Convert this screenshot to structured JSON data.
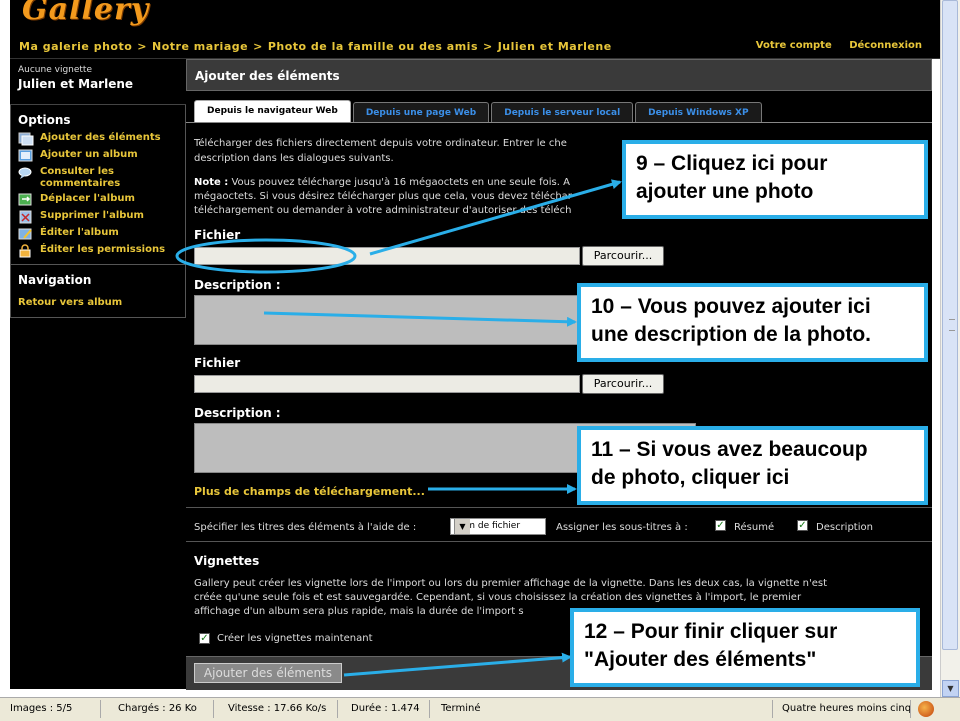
{
  "app": {
    "logo": "Gallery"
  },
  "breadcrumb": {
    "items": [
      "Ma galerie photo",
      "Notre mariage",
      "Photo de la famille ou des amis",
      "Julien et Marlene"
    ],
    "sep": ">"
  },
  "topnav": {
    "account": "Votre compte",
    "logout": "Déconnexion"
  },
  "sidebar": {
    "no_thumb": "Aucune vignette",
    "album_name": "Julien et Marlene",
    "options_title": "Options",
    "items": [
      {
        "label": "Ajouter des éléments",
        "icon": "add-items-icon"
      },
      {
        "label": "Ajouter un album",
        "icon": "add-album-icon"
      },
      {
        "label": "Consulter les commentaires",
        "icon": "comments-icon"
      },
      {
        "label": "Déplacer l'album",
        "icon": "move-icon"
      },
      {
        "label": "Supprimer l'album",
        "icon": "delete-icon"
      },
      {
        "label": "Éditer l'album",
        "icon": "edit-icon"
      },
      {
        "label": "Éditer les permissions",
        "icon": "permissions-icon"
      }
    ],
    "nav_title": "Navigation",
    "back_link": "Retour vers album"
  },
  "main": {
    "title": "Ajouter des éléments",
    "tabs": [
      "Depuis le navigateur Web",
      "Depuis une page Web",
      "Depuis le serveur local",
      "Depuis Windows XP"
    ],
    "intro_line1": "Télécharger des fichiers directement depuis votre ordinateur. Entrer le che",
    "intro_line2": "description dans les dialogues suivants.",
    "note_label": "Note :",
    "note_line1": " Vous pouvez télécharge jusqu'à 16 mégaoctets en une seule fois. A",
    "note_line2": "mégaoctets. Si vous désirez télécharger plus que cela, vous devez téléchar",
    "note_line3": "téléchargement ou demander à votre administrateur d'autoriser des téléch",
    "file_label": "Fichier",
    "desc_label": "Description :",
    "browse_label": "Parcourir...",
    "more_fields": "Plus de champs de téléchargement...",
    "titles_label": "Spécifier les titres des éléments à l'aide de :",
    "titles_select": "Nom de fichier",
    "subtitles_label": "Assigner les sous-titres à :",
    "summary_label": "Résumé",
    "description_label": "Description",
    "thumbs_title": "Vignettes",
    "thumbs_line1": "Gallery peut créer les vignette lors de l'import ou lors du premier affichage de la vignette. Dans les deux cas, la vignette n'est",
    "thumbs_line2": "créée qu'une seule fois et est sauvegardée. Cependant, si vous choisissez la création des vignettes à l'import, le premier",
    "thumbs_line3": "affichage d'un album sera plus rapide, mais la durée de l'import s",
    "create_thumbs": "Créer les vignettes maintenant",
    "submit_label": "Ajouter des éléments"
  },
  "status": {
    "images": "Images : 5/5",
    "loaded": "Chargés : 26 Ko",
    "speed": "Vitesse : 17.66 Ko/s",
    "duration": "Durée : 1.474",
    "state": "Terminé",
    "clock": "Quatre heures moins cinq"
  },
  "callouts": [
    {
      "line1": "9 – Cliquez ici pour",
      "line2": "ajouter une photo"
    },
    {
      "line1": "10 – Vous pouvez ajouter ici",
      "line2": "une description de la photo."
    },
    {
      "line1": "11 – Si vous avez beaucoup",
      "line2": "de photo, cliquer ici"
    },
    {
      "line1": "12 – Pour finir cliquer sur",
      "line2": "\"Ajouter des éléments\""
    }
  ],
  "colors": {
    "accent": "#e8c63a",
    "tab_link": "#3b8fe8",
    "callout_border": "#2aaee8",
    "logo": "#f39a1d"
  }
}
